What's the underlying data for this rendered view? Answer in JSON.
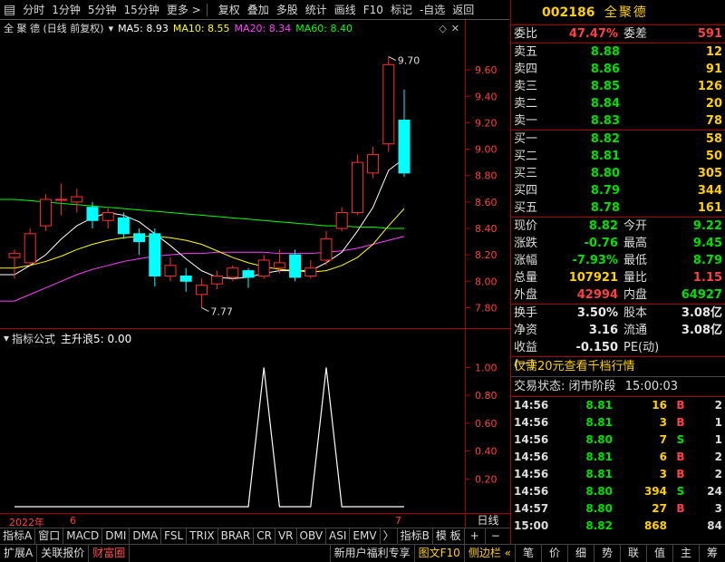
{
  "toolbar": {
    "items": [
      "分时",
      "1分钟",
      "5分钟",
      "15分钟",
      "更多 >",
      "复权",
      "叠加",
      "多股",
      "统计",
      "画线",
      "F10",
      "标记",
      "-自选",
      "返回"
    ]
  },
  "chart_header": {
    "title": "全 聚 德 (日线 前复权)",
    "ma5": "MA5: 8.93",
    "ma10": "MA10: 8.55",
    "ma20": "MA20: 8.34",
    "ma60": "MA60: 8.40"
  },
  "indicator_header": {
    "formula_label": "指标公式",
    "value_label": "主升浪5: 0.00"
  },
  "date_axis": {
    "year_label": "2022年",
    "month_6": "6",
    "month_7": "7",
    "period": "日线"
  },
  "bottom_tabs": [
    "指标A",
    "窗口",
    "MACD",
    "DMI",
    "DMA",
    "FSL",
    "TRIX",
    "BRAR",
    "CR",
    "VR",
    "OBV",
    "ASI",
    "EMV",
    "〉",
    "指标B",
    "模 板",
    "+",
    "−"
  ],
  "status_bar": {
    "left": [
      "扩展A",
      "关联报价",
      "财富圈"
    ],
    "right": [
      "新用户福利专享",
      "图文F10",
      "侧边栏 «"
    ],
    "quick": [
      "笔",
      "价",
      "细",
      "势",
      "联",
      "值",
      "主",
      "筹"
    ]
  },
  "stock": {
    "code": "002186",
    "name": "全聚德"
  },
  "order_book": {
    "weibi_label": "委比",
    "weibi": "47.47%",
    "weicha_label": "委差",
    "weicha": "591",
    "asks": [
      {
        "label": "卖五",
        "price": "8.88",
        "vol": "12"
      },
      {
        "label": "卖四",
        "price": "8.86",
        "vol": "91"
      },
      {
        "label": "卖三",
        "price": "8.85",
        "vol": "126"
      },
      {
        "label": "卖二",
        "price": "8.84",
        "vol": "20"
      },
      {
        "label": "卖一",
        "price": "8.83",
        "vol": "78"
      }
    ],
    "bids": [
      {
        "label": "买一",
        "price": "8.82",
        "vol": "58"
      },
      {
        "label": "买二",
        "price": "8.81",
        "vol": "50"
      },
      {
        "label": "买三",
        "price": "8.80",
        "vol": "305"
      },
      {
        "label": "买四",
        "price": "8.79",
        "vol": "344"
      },
      {
        "label": "买五",
        "price": "8.78",
        "vol": "161"
      }
    ]
  },
  "quote": {
    "rows1": [
      {
        "l1": "现价",
        "v1": "8.82",
        "c1": "green",
        "l2": "今开",
        "v2": "9.22",
        "c2": "green"
      },
      {
        "l1": "涨跌",
        "v1": "-0.76",
        "c1": "green",
        "l2": "最高",
        "v2": "9.45",
        "c2": "green"
      },
      {
        "l1": "涨幅",
        "v1": "-7.93%",
        "c1": "green",
        "l2": "最低",
        "v2": "8.79",
        "c2": "green"
      },
      {
        "l1": "总量",
        "v1": "107921",
        "c1": "yellow",
        "l2": "量比",
        "v2": "1.15",
        "c2": "red"
      },
      {
        "l1": "外盘",
        "v1": "42994",
        "c1": "red",
        "l2": "内盘",
        "v2": "64927",
        "c2": "green"
      }
    ],
    "rows2": [
      {
        "l1": "换手",
        "v1": "3.50%",
        "c1": "white",
        "l2": "股本",
        "v2": "3.08亿",
        "c2": "white"
      },
      {
        "l1": "净资",
        "v1": "3.16",
        "c1": "white",
        "l2": "流通",
        "v2": "3.08亿",
        "c2": "white"
      },
      {
        "l1": "收益(一)",
        "v1": "-0.150",
        "c1": "white",
        "l2": "PE(动)",
        "v2": "",
        "c2": "white"
      }
    ]
  },
  "promo": "仅需20元查看千档行情",
  "trade_state": {
    "label": "交易状态:",
    "value": "闭市阶段",
    "time": "15:00:03"
  },
  "ticks": [
    {
      "time": "14:56",
      "price": "8.81",
      "vol": "16",
      "dir": "B",
      "n": "2",
      "pc": "green",
      "vc": "yellow",
      "dc": "red"
    },
    {
      "time": "14:56",
      "price": "8.81",
      "vol": "3",
      "dir": "B",
      "n": "1",
      "pc": "green",
      "vc": "yellow",
      "dc": "red"
    },
    {
      "time": "14:56",
      "price": "8.80",
      "vol": "7",
      "dir": "S",
      "n": "1",
      "pc": "green",
      "vc": "yellow",
      "dc": "green"
    },
    {
      "time": "14:56",
      "price": "8.81",
      "vol": "6",
      "dir": "B",
      "n": "2",
      "pc": "green",
      "vc": "yellow",
      "dc": "red"
    },
    {
      "time": "14:56",
      "price": "8.81",
      "vol": "3",
      "dir": "B",
      "n": "2",
      "pc": "green",
      "vc": "yellow",
      "dc": "red"
    },
    {
      "time": "14:56",
      "price": "8.80",
      "vol": "394",
      "dir": "S",
      "n": "24",
      "pc": "green",
      "vc": "yellow",
      "dc": "green"
    },
    {
      "time": "14:57",
      "price": "8.80",
      "vol": "27",
      "dir": "B",
      "n": "3",
      "pc": "green",
      "vc": "yellow",
      "dc": "red"
    },
    {
      "time": "15:00",
      "price": "8.82",
      "vol": "868",
      "dir": "",
      "n": "84",
      "pc": "green",
      "vc": "purple",
      "dc": "red"
    }
  ],
  "colors": {
    "up": "#ff3030",
    "down": "#00ffff",
    "ma5": "#ffffff",
    "ma10": "#ffff00",
    "ma20": "#ff40ff",
    "ma60": "#00ff00",
    "grid": "#aa0000"
  },
  "chart_data": [
    {
      "type": "candlestick",
      "yticks": [
        "7.80",
        "8.00",
        "8.20",
        "8.40",
        "8.60",
        "8.80",
        "9.00",
        "9.20",
        "9.40",
        "9.60"
      ],
      "ylim": [
        7.7,
        9.8
      ],
      "annotations": [
        {
          "text": "9.70"
        },
        {
          "text": "7.77"
        }
      ],
      "candles": [
        {
          "o": 8.18,
          "c": 8.21,
          "h": 8.24,
          "l": 8.02
        },
        {
          "o": 8.14,
          "c": 8.36,
          "h": 8.4,
          "l": 8.12
        },
        {
          "o": 8.42,
          "c": 8.62,
          "h": 8.66,
          "l": 8.38
        },
        {
          "o": 8.62,
          "c": 8.62,
          "h": 8.74,
          "l": 8.5
        },
        {
          "o": 8.6,
          "c": 8.64,
          "h": 8.7,
          "l": 8.52
        },
        {
          "o": 8.56,
          "c": 8.46,
          "h": 8.6,
          "l": 8.4
        },
        {
          "o": 8.46,
          "c": 8.52,
          "h": 8.56,
          "l": 8.4
        },
        {
          "o": 8.48,
          "c": 8.36,
          "h": 8.52,
          "l": 8.32
        },
        {
          "o": 8.36,
          "c": 8.3,
          "h": 8.4,
          "l": 8.2
        },
        {
          "o": 8.36,
          "c": 8.04,
          "h": 8.4,
          "l": 7.96
        },
        {
          "o": 8.04,
          "c": 8.12,
          "h": 8.18,
          "l": 8.0
        },
        {
          "o": 8.04,
          "c": 8.0,
          "h": 8.1,
          "l": 7.92
        },
        {
          "o": 7.9,
          "c": 7.97,
          "h": 8.02,
          "l": 7.8
        },
        {
          "o": 7.98,
          "c": 8.04,
          "h": 8.08,
          "l": 7.94
        },
        {
          "o": 8.03,
          "c": 8.1,
          "h": 8.12,
          "l": 8.0
        },
        {
          "o": 8.08,
          "c": 8.03,
          "h": 8.1,
          "l": 7.95
        },
        {
          "o": 8.04,
          "c": 8.16,
          "h": 8.2,
          "l": 8.02
        },
        {
          "o": 8.1,
          "c": 8.14,
          "h": 8.24,
          "l": 8.06
        },
        {
          "o": 8.2,
          "c": 8.03,
          "h": 8.24,
          "l": 8.0
        },
        {
          "o": 8.04,
          "c": 8.1,
          "h": 8.16,
          "l": 8.02
        },
        {
          "o": 8.16,
          "c": 8.32,
          "h": 8.38,
          "l": 8.12
        },
        {
          "o": 8.4,
          "c": 8.52,
          "h": 8.56,
          "l": 8.38
        },
        {
          "o": 8.52,
          "c": 8.9,
          "h": 8.96,
          "l": 8.5
        },
        {
          "o": 8.82,
          "c": 8.96,
          "h": 9.02,
          "l": 8.78
        },
        {
          "o": 9.04,
          "c": 9.64,
          "h": 9.7,
          "l": 8.98
        },
        {
          "o": 9.22,
          "c": 8.82,
          "h": 9.45,
          "l": 8.79
        }
      ],
      "ma": {
        "ma5": [
          8.05,
          8.12,
          8.2,
          8.32,
          8.42,
          8.48,
          8.52,
          8.5,
          8.45,
          8.36,
          8.27,
          8.17,
          8.08,
          8.03,
          8.02,
          8.03,
          8.06,
          8.08,
          8.08,
          8.08,
          8.14,
          8.22,
          8.38,
          8.56,
          8.84,
          8.93
        ],
        "ma10": [
          8.1,
          8.12,
          8.15,
          8.19,
          8.24,
          8.28,
          8.31,
          8.33,
          8.34,
          8.34,
          8.33,
          8.31,
          8.28,
          8.23,
          8.18,
          8.14,
          8.11,
          8.09,
          8.08,
          8.07,
          8.08,
          8.12,
          8.18,
          8.28,
          8.42,
          8.55
        ],
        "ma20": [
          7.85,
          7.9,
          7.95,
          8.0,
          8.05,
          8.09,
          8.12,
          8.15,
          8.17,
          8.19,
          8.2,
          8.21,
          8.21,
          8.22,
          8.22,
          8.22,
          8.22,
          8.21,
          8.21,
          8.21,
          8.22,
          8.23,
          8.25,
          8.28,
          8.31,
          8.34
        ],
        "ma60": [
          8.62,
          8.61,
          8.6,
          8.59,
          8.58,
          8.57,
          8.56,
          8.55,
          8.54,
          8.53,
          8.52,
          8.51,
          8.5,
          8.49,
          8.48,
          8.47,
          8.46,
          8.45,
          8.44,
          8.43,
          8.42,
          8.42,
          8.41,
          8.41,
          8.4,
          8.4
        ]
      }
    },
    {
      "type": "line",
      "name": "主升浪5",
      "yticks": [
        "0.20",
        "0.40",
        "0.60",
        "0.80",
        "1.00"
      ],
      "ylim": [
        0,
        1.12
      ],
      "values": [
        0,
        0,
        0,
        0,
        0,
        0,
        0,
        0,
        0,
        0,
        0,
        0,
        0,
        0,
        0,
        0,
        1,
        0,
        0,
        0,
        1,
        0,
        0,
        0,
        0,
        0
      ]
    }
  ]
}
